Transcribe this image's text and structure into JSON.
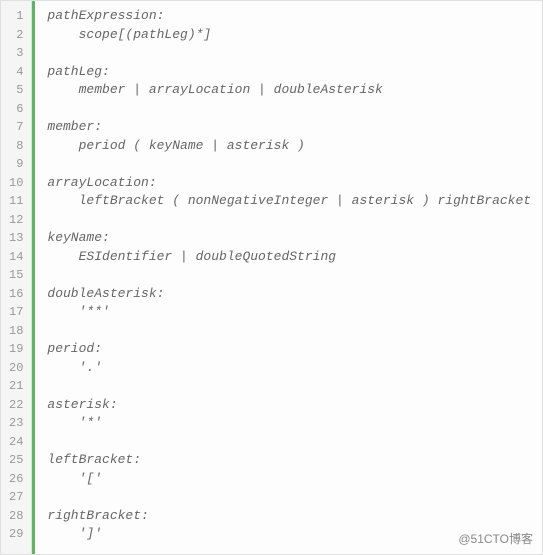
{
  "code": {
    "lines": [
      {
        "num": "1",
        "text": "pathExpression:"
      },
      {
        "num": "2",
        "text": "    scope[(pathLeg)*]"
      },
      {
        "num": "3",
        "text": ""
      },
      {
        "num": "4",
        "text": "pathLeg:"
      },
      {
        "num": "5",
        "text": "    member | arrayLocation | doubleAsterisk"
      },
      {
        "num": "6",
        "text": ""
      },
      {
        "num": "7",
        "text": "member:"
      },
      {
        "num": "8",
        "text": "    period ( keyName | asterisk )"
      },
      {
        "num": "9",
        "text": ""
      },
      {
        "num": "10",
        "text": "arrayLocation:"
      },
      {
        "num": "11",
        "text": "    leftBracket ( nonNegativeInteger | asterisk ) rightBracket"
      },
      {
        "num": "12",
        "text": ""
      },
      {
        "num": "13",
        "text": "keyName:"
      },
      {
        "num": "14",
        "text": "    ESIdentifier | doubleQuotedString"
      },
      {
        "num": "15",
        "text": ""
      },
      {
        "num": "16",
        "text": "doubleAsterisk:"
      },
      {
        "num": "17",
        "text": "    '**'"
      },
      {
        "num": "18",
        "text": ""
      },
      {
        "num": "19",
        "text": "period:"
      },
      {
        "num": "20",
        "text": "    '.'"
      },
      {
        "num": "21",
        "text": ""
      },
      {
        "num": "22",
        "text": "asterisk:"
      },
      {
        "num": "23",
        "text": "    '*'"
      },
      {
        "num": "24",
        "text": ""
      },
      {
        "num": "25",
        "text": "leftBracket:"
      },
      {
        "num": "26",
        "text": "    '['"
      },
      {
        "num": "27",
        "text": ""
      },
      {
        "num": "28",
        "text": "rightBracket:"
      },
      {
        "num": "29",
        "text": "    ']'"
      }
    ]
  },
  "watermark": "@51CTO博客"
}
